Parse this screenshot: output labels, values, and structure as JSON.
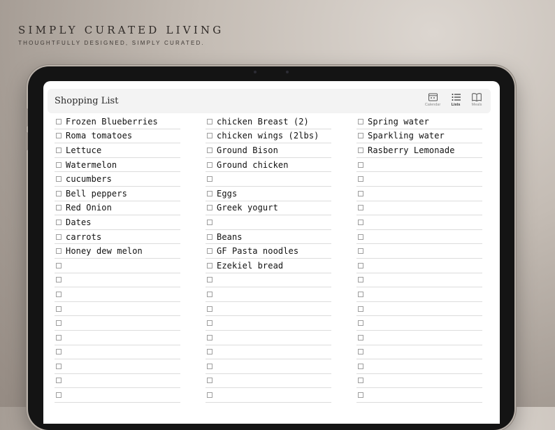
{
  "brand": {
    "title": "SIMPLY CURATED LIVING",
    "tagline": "THOUGHTFULLY DESIGNED, SIMPLY CURATED."
  },
  "page": {
    "title": "Shopping List"
  },
  "nav": [
    {
      "label": "Calendar",
      "icon": "calendar-icon",
      "active": false
    },
    {
      "label": "Lists",
      "icon": "list-icon",
      "active": true
    },
    {
      "label": "Meals",
      "icon": "book-icon",
      "active": false
    }
  ],
  "columns": [
    [
      "Frozen Blueberries",
      "Roma tomatoes",
      "Lettuce",
      "Watermelon",
      "cucumbers",
      "Bell peppers",
      "Red Onion",
      "Dates",
      "carrots",
      "Honey dew melon",
      "",
      "",
      "",
      "",
      "",
      "",
      "",
      "",
      "",
      ""
    ],
    [
      "chicken Breast (2)",
      "chicken wings (2lbs)",
      "Ground Bison",
      "Ground chicken",
      "",
      "Eggs",
      "Greek yogurt",
      "",
      "Beans",
      "GF Pasta noodles",
      "Ezekiel bread",
      "",
      "",
      "",
      "",
      "",
      "",
      "",
      "",
      ""
    ],
    [
      "Spring water",
      "Sparkling water",
      "Rasberry Lemonade",
      "",
      "",
      "",
      "",
      "",
      "",
      "",
      "",
      "",
      "",
      "",
      "",
      "",
      "",
      "",
      "",
      ""
    ]
  ]
}
